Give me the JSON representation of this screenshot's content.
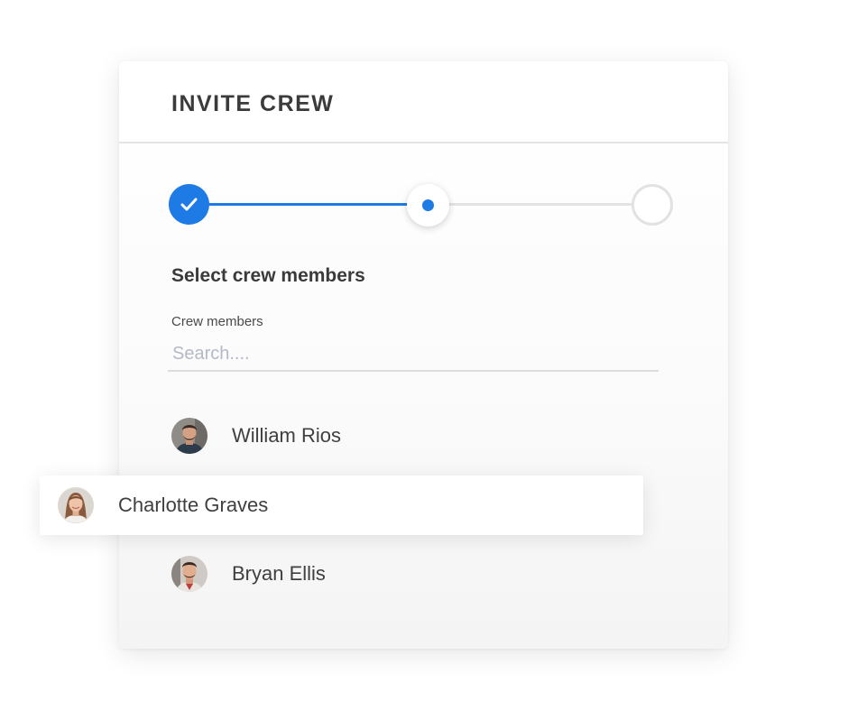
{
  "dialog": {
    "title": "INVITE CREW"
  },
  "stepper": {
    "steps": [
      {
        "state": "complete",
        "icon": "check-icon"
      },
      {
        "state": "current"
      },
      {
        "state": "upcoming"
      }
    ],
    "colors": {
      "accent": "#1e7be6",
      "inactive": "#e3e3e3"
    }
  },
  "section": {
    "title": "Select crew members"
  },
  "search": {
    "label": "Crew members",
    "placeholder": "Search....",
    "value": ""
  },
  "members": [
    {
      "name": "William Rios",
      "avatar": "avatar-man-beard"
    },
    {
      "name": "Charlotte Graves",
      "avatar": "avatar-woman",
      "state": "dragging"
    },
    {
      "name": "Bryan Ellis",
      "avatar": "avatar-man-glasses"
    }
  ]
}
